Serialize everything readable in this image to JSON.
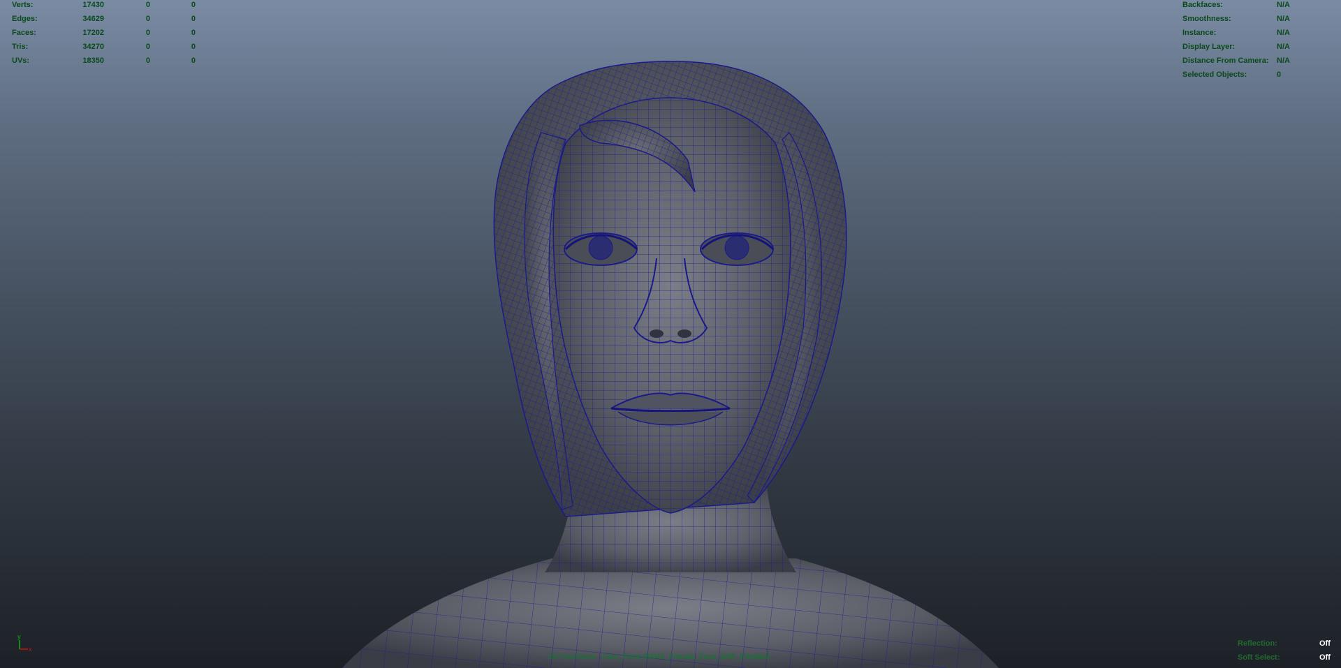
{
  "stats": {
    "rows": [
      {
        "label": "Verts:",
        "v1": "17430",
        "v2": "0",
        "v3": "0"
      },
      {
        "label": "Edges:",
        "v1": "34629",
        "v2": "0",
        "v3": "0"
      },
      {
        "label": "Faces:",
        "v1": "17202",
        "v2": "0",
        "v3": "0"
      },
      {
        "label": "Tris:",
        "v1": "34270",
        "v2": "0",
        "v3": "0"
      },
      {
        "label": "UVs:",
        "v1": "18350",
        "v2": "0",
        "v3": "0"
      }
    ]
  },
  "object_info": {
    "rows": [
      {
        "label": "Backfaces:",
        "value": "N/A"
      },
      {
        "label": "Smoothness:",
        "value": "N/A"
      },
      {
        "label": "Instance:",
        "value": "N/A"
      },
      {
        "label": "Display Layer:",
        "value": "N/A"
      },
      {
        "label": "Distance From Camera:",
        "value": "N/A"
      },
      {
        "label": "Selected Objects:",
        "value": "0"
      }
    ]
  },
  "toggles": {
    "rows": [
      {
        "label": "Reflection:",
        "value": "Off"
      },
      {
        "label": "Soft Select:",
        "value": "Off"
      }
    ]
  },
  "viewport": {
    "camera_label": "2D Pan/Zoom : Cam_Front (Bi046_Female_Face_With_Pimples)"
  },
  "axis": {
    "y_label": "y",
    "x_label": "x"
  },
  "colors": {
    "hud_text": "#0a4a1a",
    "wire": "#1a1a8a",
    "mesh": "#5a5d66",
    "axis_x": "#d01010",
    "axis_y": "#10b010"
  }
}
